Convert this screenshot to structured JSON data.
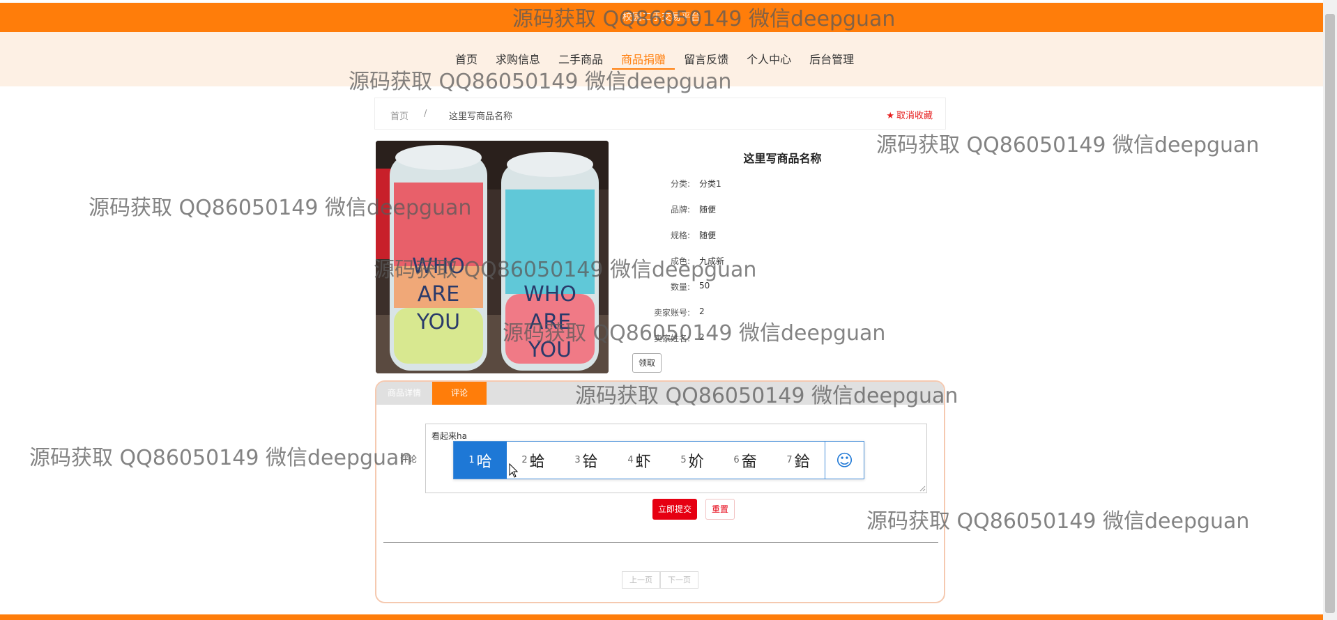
{
  "topbar": {
    "title": "校园二手交易平台"
  },
  "nav": {
    "items": [
      {
        "label": "首页"
      },
      {
        "label": "求购信息"
      },
      {
        "label": "二手商品"
      },
      {
        "label": "商品捐赠"
      },
      {
        "label": "留言反馈"
      },
      {
        "label": "个人中心"
      },
      {
        "label": "后台管理"
      }
    ],
    "active_index": 3
  },
  "breadcrumb": {
    "home": "首页",
    "separator": "/",
    "current": "这里写商品名称",
    "favorite_label": "取消收藏"
  },
  "product": {
    "name": "这里写商品名称",
    "fields": [
      {
        "label": "分类:",
        "value": "分类1"
      },
      {
        "label": "品牌:",
        "value": "随便"
      },
      {
        "label": "规格:",
        "value": "随便"
      },
      {
        "label": "成色:",
        "value": "九成新"
      },
      {
        "label": "数量:",
        "value": "50"
      },
      {
        "label": "卖家账号:",
        "value": "2"
      },
      {
        "label": "卖家姓名:",
        "value": "2"
      }
    ],
    "claim_label": "领取",
    "image_text": {
      "line1": "WHO",
      "line2": "ARE",
      "line3": "YOU"
    }
  },
  "tabs": {
    "items": [
      {
        "label": "商品详情"
      },
      {
        "label": "评论"
      }
    ],
    "active_index": 1
  },
  "comment": {
    "label": "评论",
    "value": "看起来ha",
    "submit_label": "立即提交",
    "reset_label": "重置"
  },
  "ime": {
    "candidates": [
      {
        "num": "1",
        "char": "哈"
      },
      {
        "num": "2",
        "char": "蛤"
      },
      {
        "num": "3",
        "char": "铪"
      },
      {
        "num": "4",
        "char": "虾"
      },
      {
        "num": "5",
        "char": "妎"
      },
      {
        "num": "6",
        "char": "奤"
      },
      {
        "num": "7",
        "char": "鉿"
      }
    ],
    "selected_index": 0,
    "emoji": "☺"
  },
  "pager": {
    "prev_label": "上一页",
    "next_label": "下一页"
  },
  "watermark": {
    "text": "源码获取 QQ86050149 微信deepguan"
  },
  "colors": {
    "accent": "#ff7d0a",
    "danger": "#e60012",
    "ime_select": "#1e78d6"
  }
}
